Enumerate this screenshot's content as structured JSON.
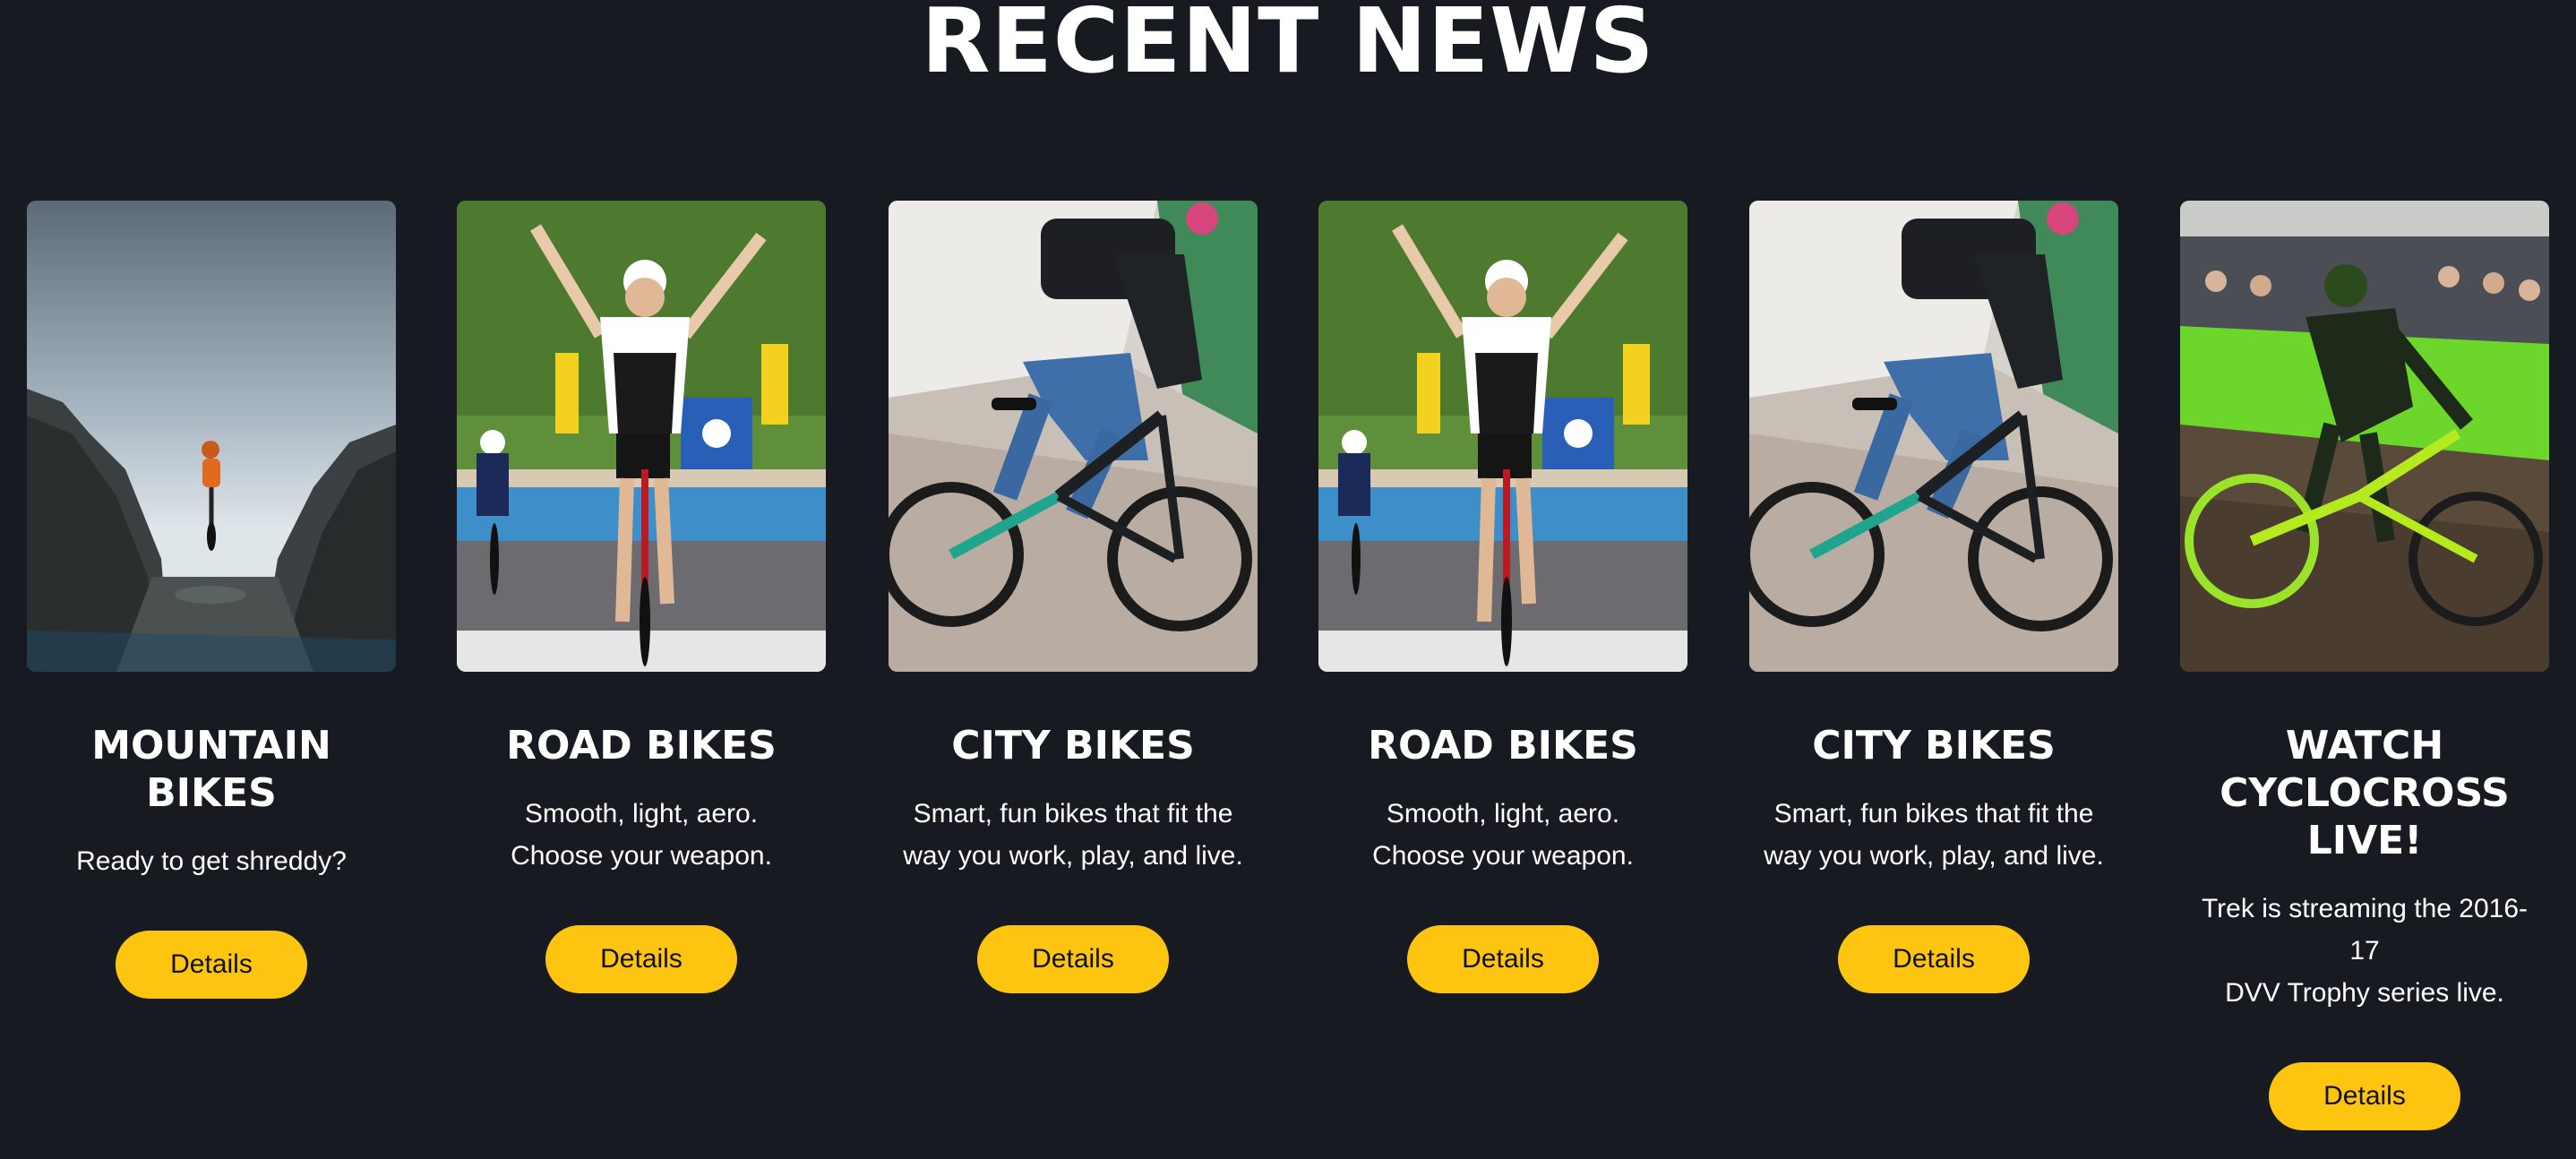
{
  "page": {
    "title": "RECENT NEWS"
  },
  "colors": {
    "background": "#171b21",
    "accent": "#fdc510",
    "text": "#ffffff",
    "button_text": "#111111"
  },
  "cards": [
    {
      "image": "mountain-bike-rider-photo",
      "title": "MOUNTAIN BIKES",
      "description": [
        "Ready to get shreddy?"
      ],
      "button": "Details"
    },
    {
      "image": "road-bike-race-winner-photo",
      "title": "ROAD BIKES",
      "description": [
        "Smooth, light, aero.",
        "Choose your weapon."
      ],
      "button": "Details"
    },
    {
      "image": "city-bike-rider-photo",
      "title": "CITY BIKES",
      "description": [
        "Smart, fun bikes that fit the",
        "way you work, play, and live."
      ],
      "button": "Details"
    },
    {
      "image": "road-bike-race-winner-photo",
      "title": "ROAD BIKES",
      "description": [
        "Smooth, light, aero.",
        "Choose your weapon."
      ],
      "button": "Details"
    },
    {
      "image": "city-bike-rider-photo",
      "title": "CITY BIKES",
      "description": [
        "Smart, fun bikes that fit the",
        "way you work, play, and live."
      ],
      "button": "Details"
    },
    {
      "image": "cyclocross-rider-photo",
      "title": "WATCH CYCLOCROSS LIVE!",
      "description": [
        "Trek is streaming the 2016-17",
        "DVV Trophy series live."
      ],
      "button": "Details"
    }
  ]
}
